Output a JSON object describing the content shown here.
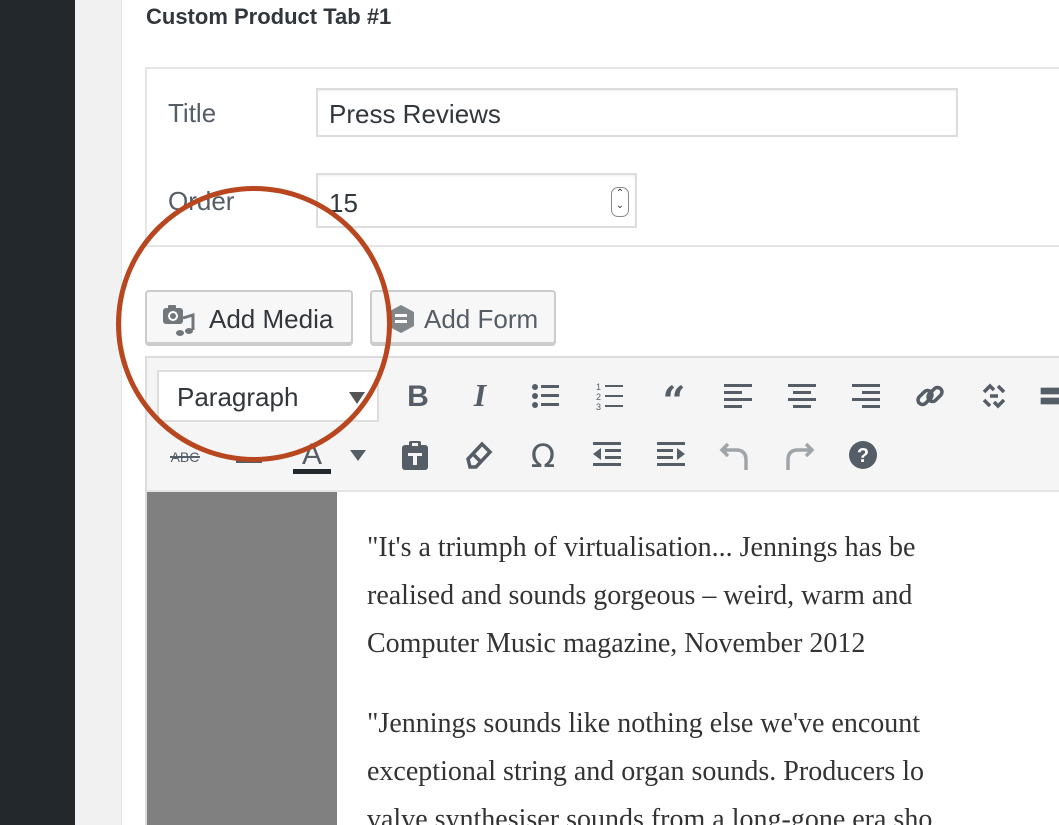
{
  "section": {
    "title": "Custom Product Tab #1"
  },
  "fields": {
    "title_label": "Title",
    "title_value": "Press Reviews",
    "order_label": "Order",
    "order_value": "15"
  },
  "buttons": {
    "add_media": "Add Media",
    "add_form": "Add Form"
  },
  "toolbar": {
    "format_select": "Paragraph",
    "row1_icons": [
      "bold-icon",
      "italic-icon",
      "bullet-list-icon",
      "numbered-list-icon",
      "blockquote-icon",
      "align-left-icon",
      "align-center-icon",
      "align-right-icon",
      "link-icon",
      "unlink-icon",
      "more-icon"
    ],
    "row2_icons": [
      "strikethrough-icon",
      "horizontal-rule-icon",
      "text-color-icon",
      "paste-as-text-icon",
      "clear-formatting-icon",
      "special-character-icon",
      "outdent-icon",
      "indent-icon",
      "undo-icon",
      "redo-icon",
      "help-icon"
    ]
  },
  "content": {
    "paragraph1": [
      "\"It's a triumph of virtualisation... Jennings has be",
      "realised and sounds gorgeous – weird, warm and",
      "Computer Music magazine, November 2012"
    ],
    "paragraph2": [
      "\"Jennings sounds like nothing else we've encount",
      "exceptional string and organ sounds. Producers lo",
      "valve synthesiser sounds from a long-gone era sho"
    ]
  },
  "colors": {
    "highlight_circle": "#b8461f",
    "sidebar": "#23282d"
  }
}
